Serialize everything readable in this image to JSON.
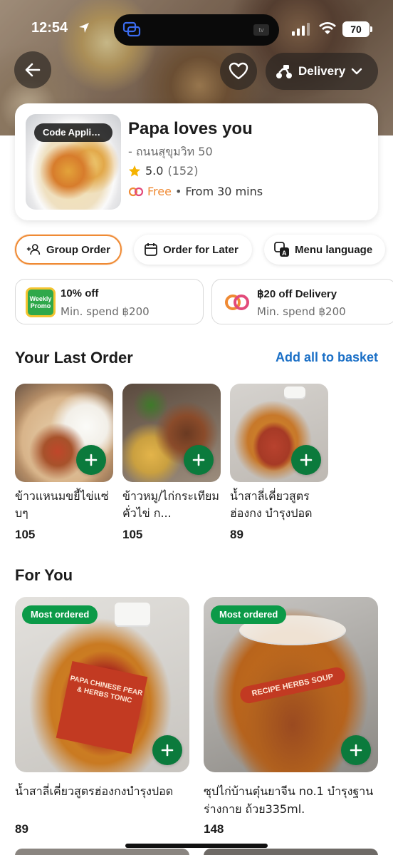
{
  "status_bar": {
    "time": "12:54",
    "island_tv": "tv",
    "battery": "70"
  },
  "header": {
    "delivery_label": "Delivery"
  },
  "restaurant": {
    "badge": "Code Applic...",
    "name": "Papa loves you",
    "branch": "- ถนนสุขุมวิท 50",
    "rating": "5.0",
    "rating_count": "(152)",
    "delivery_fee": "Free",
    "separator": "•",
    "delivery_time": "From 30 mins"
  },
  "actions": {
    "group_order": "Group Order",
    "order_later": "Order for Later",
    "menu_language": "Menu language"
  },
  "promos": [
    {
      "icon_text": "Weekly Promo",
      "title": "10% off",
      "subtitle": "Min. spend ฿200"
    },
    {
      "title": "฿20 off Delivery",
      "subtitle": "Min. spend ฿200"
    }
  ],
  "last_order": {
    "title": "Your Last Order",
    "add_all": "Add all to basket",
    "items": [
      {
        "name": "ข้าวแหนมขยี้ไข่แซ่บๆ",
        "price": "105"
      },
      {
        "name": "ข้าวหมู/ไก่กระเทียมคั่วไข่ ก...",
        "price": "105"
      },
      {
        "name": "น้ำสาลี่เคี่ยวสูตรฮ่องกง บำรุงปอด",
        "price": "89"
      }
    ]
  },
  "for_you": {
    "title": "For You",
    "items": [
      {
        "tag": "Most ordered",
        "name": "น้ำสาลี่เคี่ยวสูตรฮ่องกงบำรุงปอด",
        "price": "89",
        "label_text": "PAPA CHINESE PEAR & HERBS TONIC"
      },
      {
        "tag": "Most ordered",
        "name": "ซุปไก่บ้านตุ๋นยาจีน no.1 บำรุงฐานร่างกาย ถ้วย335ml.",
        "price": "148",
        "label_text": "RECIPE HERBS SOUP"
      }
    ]
  },
  "colors": {
    "accent_orange": "#ef8a34",
    "link_blue": "#1a6fc6",
    "plus_green": "#0b7a3c",
    "tag_green": "#0b9a48"
  }
}
